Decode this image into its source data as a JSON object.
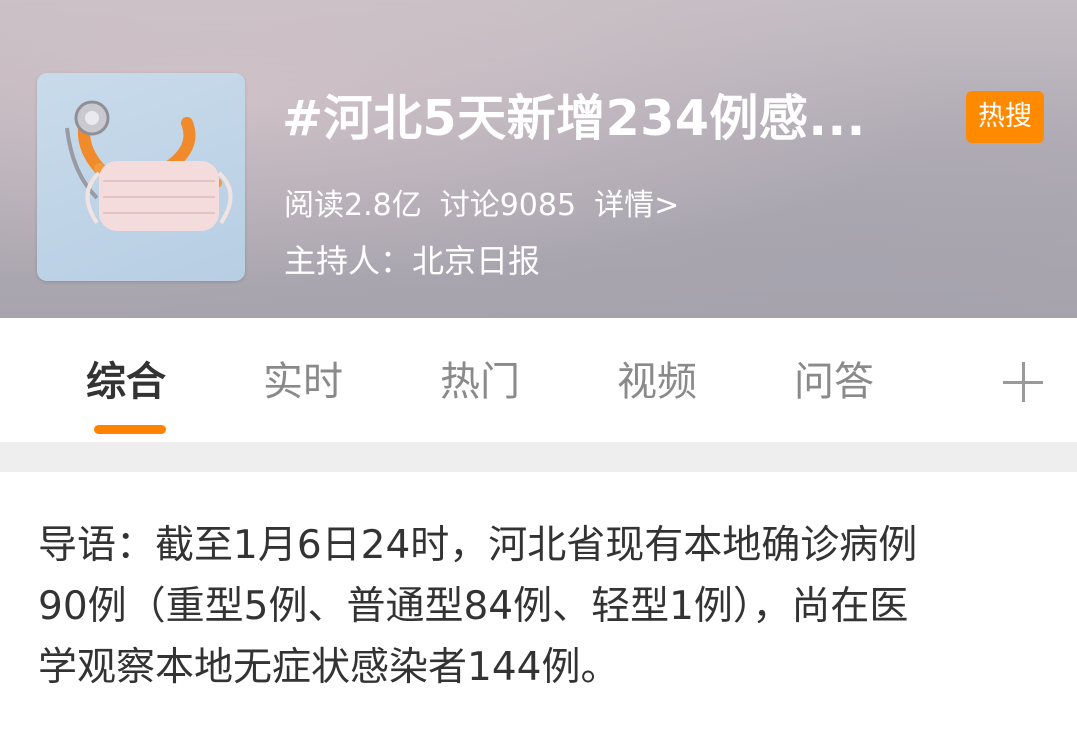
{
  "header": {
    "title": "#河北5天新增234例感...",
    "badge": "热搜",
    "stats": {
      "reads": "阅读2.8亿",
      "discussions": "讨论9085",
      "details_link": "详情>"
    },
    "host": "主持人：北京日报",
    "thumbnail_icon": "mask-stethoscope-image"
  },
  "tabs": [
    {
      "label": "综合",
      "active": true
    },
    {
      "label": "实时",
      "active": false
    },
    {
      "label": "热门",
      "active": false
    },
    {
      "label": "视频",
      "active": false
    },
    {
      "label": "问答",
      "active": false
    }
  ],
  "tab_add_icon": "plus-icon",
  "accent_color": "#ff8200",
  "badge_color": "#ff8a00",
  "intro": {
    "text": "导语：截至1月6日24时，河北省现有本地确诊病例\n90例（重型5例、普通型84例、轻型1例），尚在医\n学观察本地无症状感染者144例。"
  }
}
